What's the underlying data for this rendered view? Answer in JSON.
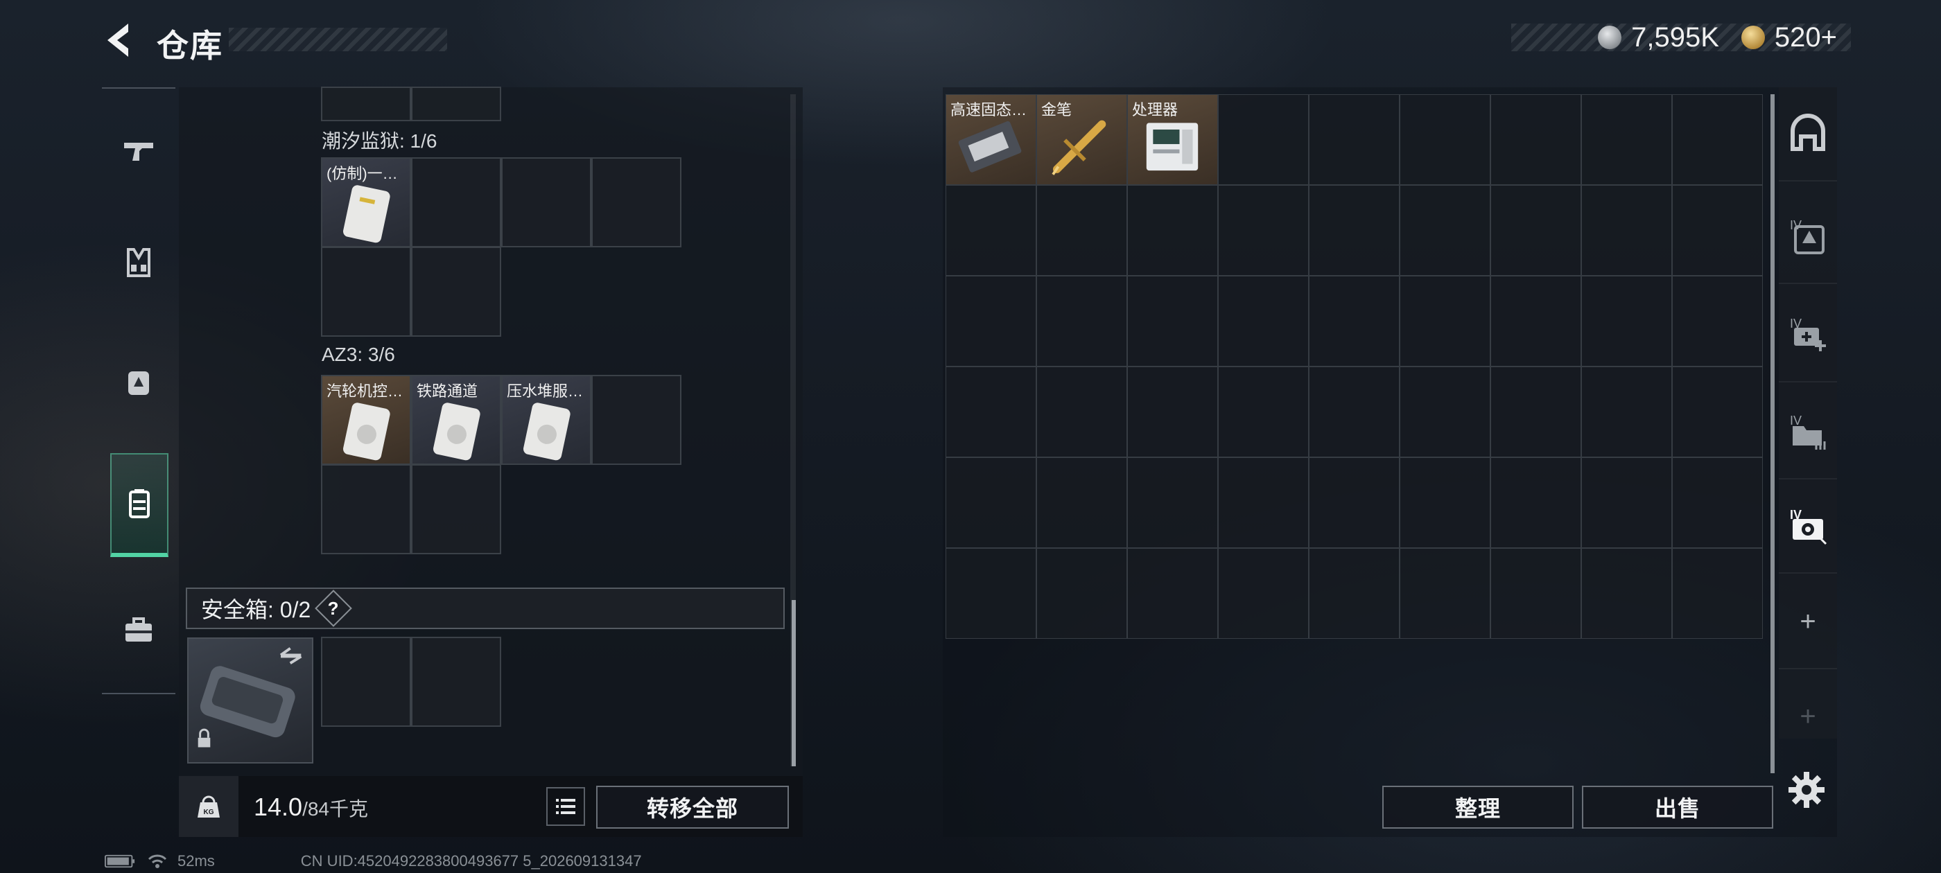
{
  "header": {
    "title": "仓库",
    "currency_silver": "7,595K",
    "currency_gold": "520+"
  },
  "left": {
    "sections": [
      {
        "label": "潮汐监狱: 1/6",
        "items": [
          "(仿制)一…"
        ]
      },
      {
        "label": "AZ3: 3/6",
        "items": [
          "汽轮机控…",
          "铁路通道",
          "压水堆服…"
        ]
      }
    ],
    "safe_box": {
      "label": "安全箱: 0/2",
      "help": "?"
    },
    "weight": {
      "current": "14.0",
      "max": "/84千克"
    },
    "transfer_all": "转移全部"
  },
  "right": {
    "items": [
      "高速固态…",
      "金笔",
      "处理器"
    ],
    "sort_button": "整理",
    "sell_button": "出售",
    "side_tab_plus": "+"
  },
  "status": {
    "ping": "52ms",
    "uid": "CN UID:4520492283800493677 5_202609131347"
  },
  "colors": {
    "accent": "#52d3a4",
    "item_brown": "#5a4a3a",
    "item_gray": "#3a3e4a"
  }
}
